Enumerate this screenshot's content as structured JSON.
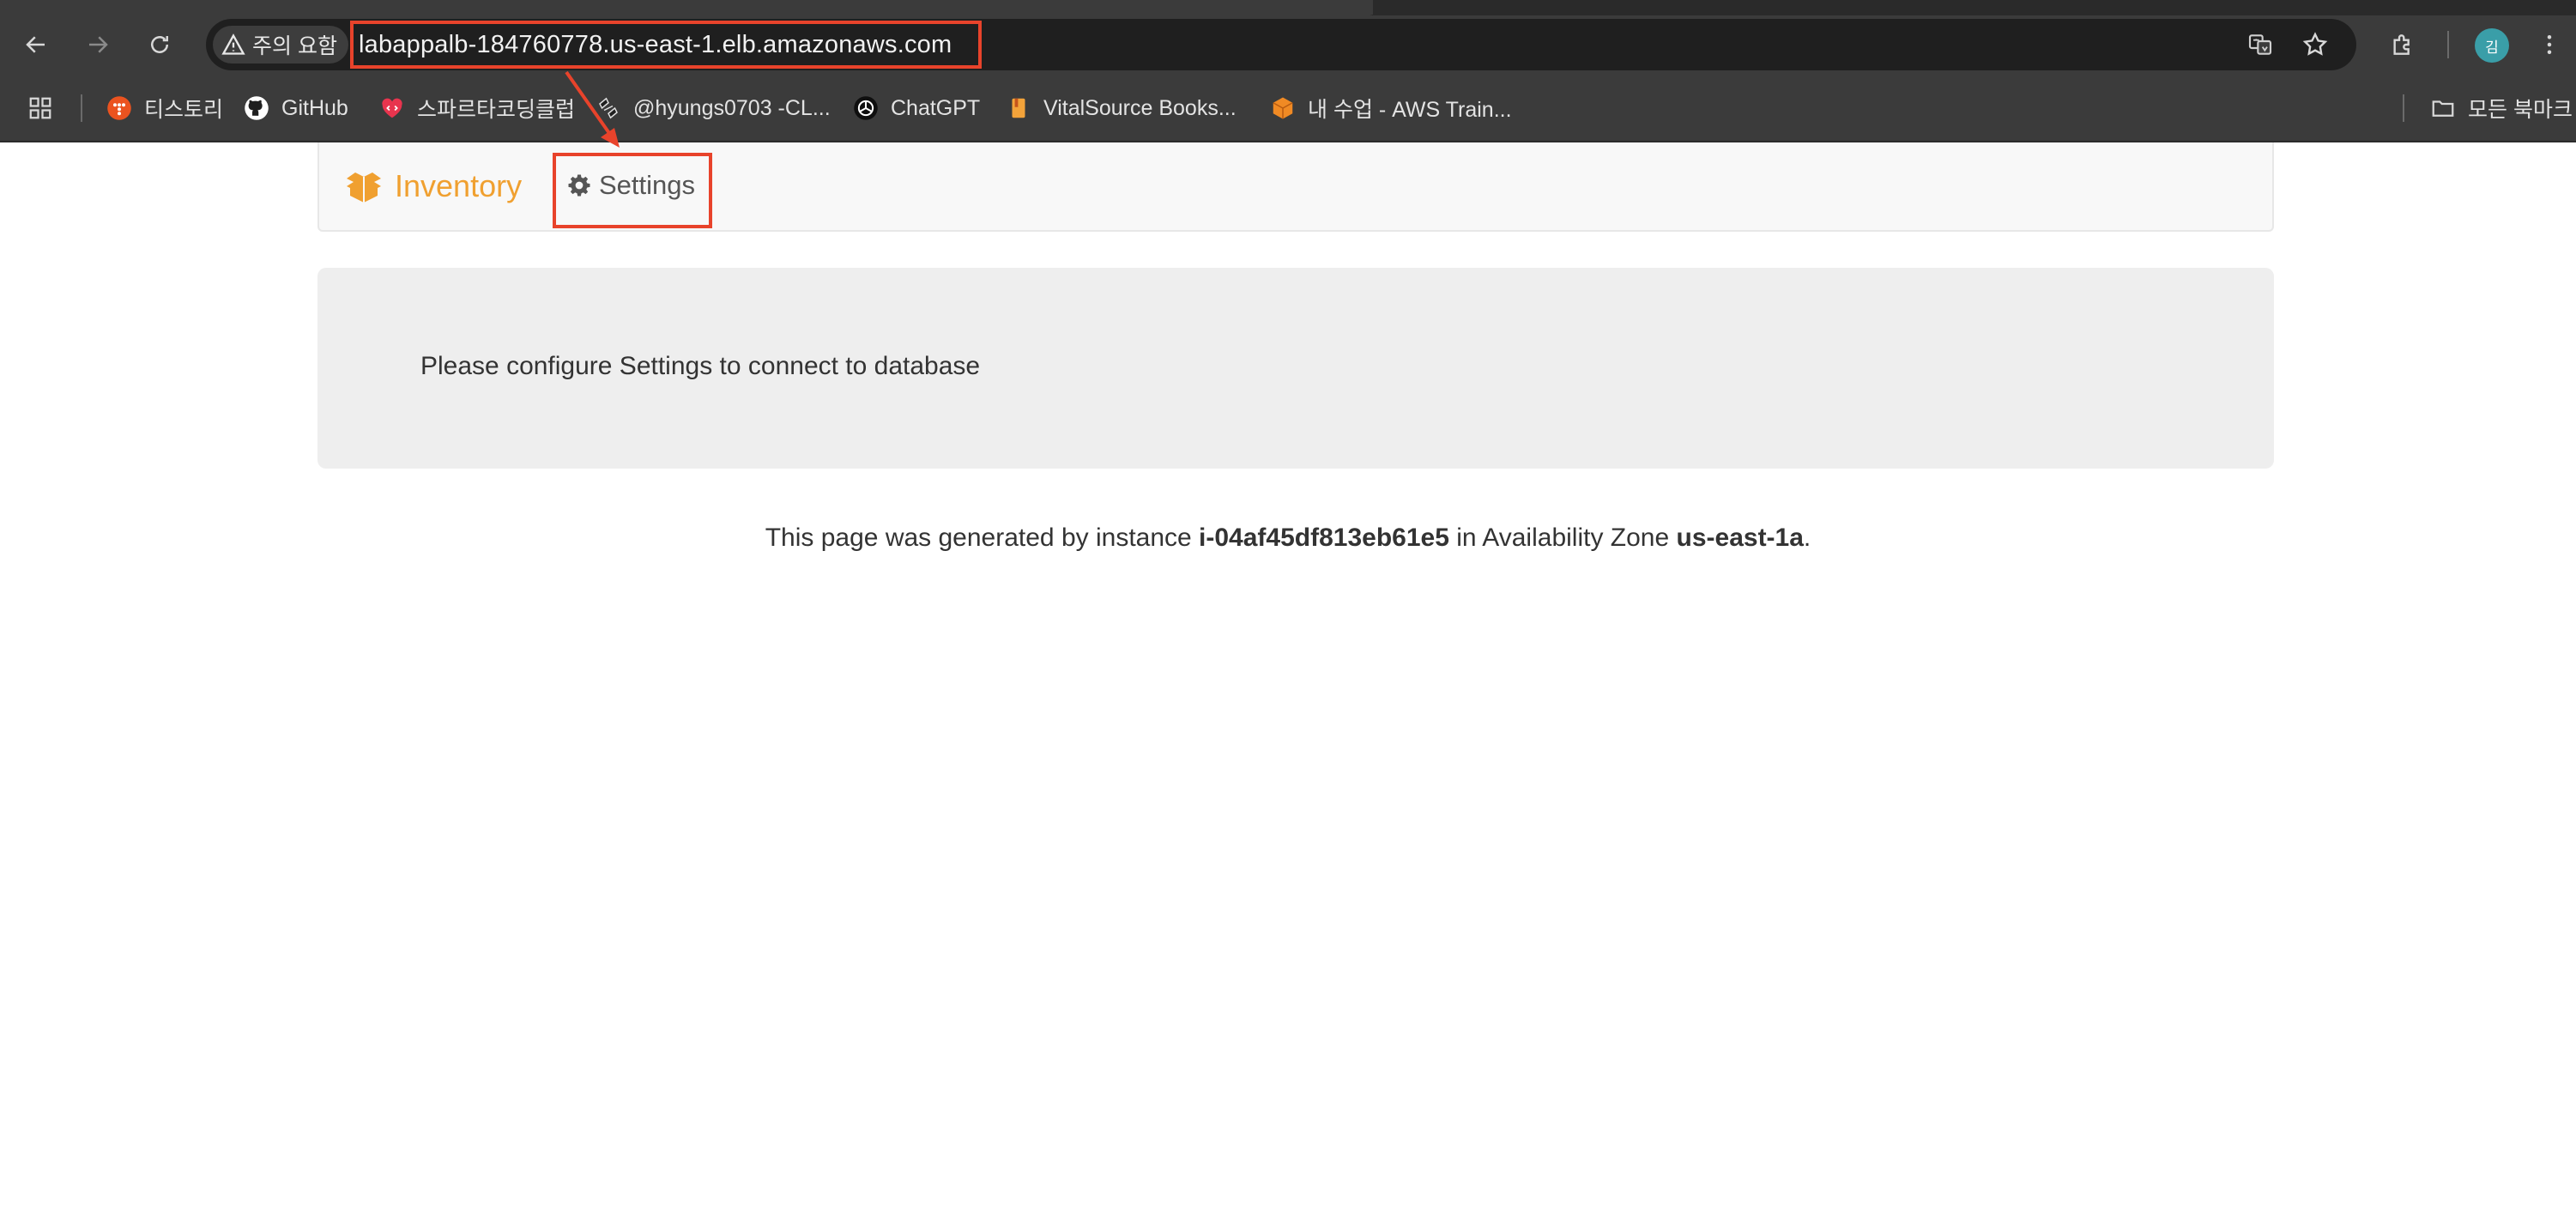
{
  "browser": {
    "security_label": "주의 요함",
    "url": "labappalb-184760778.us-east-1.elb.amazonaws.com",
    "avatar_initial": "김",
    "bookmarks": [
      {
        "label": "티스토리",
        "icon": "tistory-icon",
        "color": "#eb531f"
      },
      {
        "label": "GitHub",
        "icon": "github-icon",
        "color": "#ffffff"
      },
      {
        "label": "스파르타코딩클럽",
        "icon": "spartacoding-icon",
        "color": "#e8344e"
      },
      {
        "label": "@hyungs0703 -CL...",
        "icon": "hyungs-icon",
        "color": "#ffffff"
      },
      {
        "label": "ChatGPT",
        "icon": "chatgpt-icon",
        "color": "#ffffff"
      },
      {
        "label": "VitalSource Books...",
        "icon": "vitalsource-icon",
        "color": "#f3a33a"
      },
      {
        "label": "내 수업 - AWS Train...",
        "icon": "aws-training-icon",
        "color": "#f08a24"
      }
    ],
    "all_bookmarks_label": "모든 북마크"
  },
  "page": {
    "brand": "Inventory",
    "nav_settings": "Settings",
    "message": "Please configure Settings to connect to database",
    "footer": {
      "prefix": "This page was generated by instance ",
      "instance_id": "i-04af45df813eb61e5",
      "middle": " in Availability Zone ",
      "zone": "us-east-1a",
      "suffix": "."
    }
  },
  "colors": {
    "brand": "#f0a030",
    "annotation": "#e8432b",
    "chrome": "#3b3b3b"
  }
}
